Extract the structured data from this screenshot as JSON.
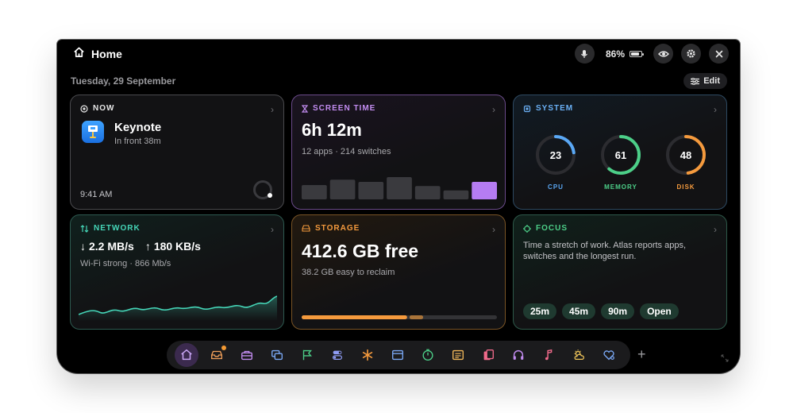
{
  "header": {
    "title": "Home",
    "battery": "86%",
    "battery_level": 0.86
  },
  "date": "Tuesday, 29 September",
  "edit_label": "Edit",
  "now": {
    "heading": "NOW",
    "app": "Keynote",
    "detail": "In front 38m",
    "time": "9:41 AM"
  },
  "screen_time": {
    "heading": "SCREEN TIME",
    "total": "6h 12m",
    "detail": "12 apps · 214 switches",
    "bars": [
      0.45,
      0.62,
      0.55,
      0.7,
      0.42,
      0.28,
      0.55
    ],
    "highlight_color": "#b57cf2"
  },
  "system": {
    "heading": "SYSTEM",
    "gauges": [
      {
        "label": "CPU",
        "value": 23,
        "color": "#5aa8f5"
      },
      {
        "label": "MEMORY",
        "value": 61,
        "color": "#4ccf88"
      },
      {
        "label": "DISK",
        "value": 48,
        "color": "#f59a3d"
      }
    ]
  },
  "network": {
    "heading": "NETWORK",
    "down": "2.2 MB/s",
    "up": "180 KB/s",
    "detail": "Wi-Fi strong · 866 Mb/s",
    "accent": "#45d6b8"
  },
  "storage": {
    "heading": "STORAGE",
    "free": "412.6 GB free",
    "detail": "38.2 GB easy to reclaim",
    "used_fraction": 0.54,
    "reclaim_fraction": 0.07,
    "accent": "#f59a3d"
  },
  "focus": {
    "heading": "FOCUS",
    "text": "Time a stretch of work. Atlas reports apps, switches and the longest run.",
    "buttons": [
      "25m",
      "45m",
      "90m",
      "Open"
    ]
  },
  "dock": {
    "items": [
      {
        "name": "home-icon",
        "color": "#c9a6f5",
        "active": true
      },
      {
        "name": "inbox-icon",
        "color": "#f2a05a",
        "badge": true
      },
      {
        "name": "briefcase-icon",
        "color": "#c28cf0"
      },
      {
        "name": "windows-icon",
        "color": "#7aa8f5"
      },
      {
        "name": "flag-icon",
        "color": "#4ccf88"
      },
      {
        "name": "toggles-icon",
        "color": "#8f9cf5"
      },
      {
        "name": "asterisk-icon",
        "color": "#f59a3d"
      },
      {
        "name": "calendar-icon",
        "color": "#7aa8f5"
      },
      {
        "name": "timer-icon",
        "color": "#4ccf88"
      },
      {
        "name": "note-icon",
        "color": "#f2b85a"
      },
      {
        "name": "documents-icon",
        "color": "#f06a8a"
      },
      {
        "name": "headphones-icon",
        "color": "#c28cf0"
      },
      {
        "name": "music-icon",
        "color": "#f06a8a"
      },
      {
        "name": "weather-icon",
        "color": "#f2c75a"
      },
      {
        "name": "health-icon",
        "color": "#7aa8f5"
      }
    ]
  }
}
